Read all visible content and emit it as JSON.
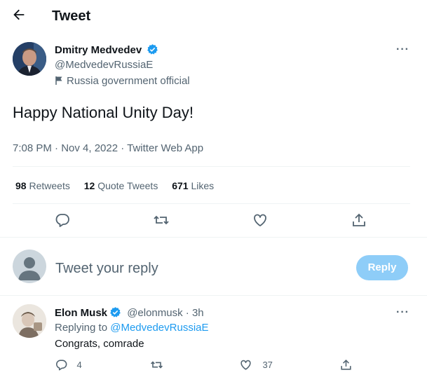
{
  "header": {
    "title": "Tweet",
    "back_icon": "arrow-left-icon"
  },
  "tweet": {
    "author_name": "Dmitry Medvedev",
    "handle": "@MedvedevRussiaE",
    "affiliation": "Russia government official",
    "text": "Happy National Unity Day!",
    "meta": "7:08 PM · Nov 4, 2022 · Twitter Web App",
    "stats": {
      "retweets_count": "98",
      "retweets_label": "Retweets",
      "quotes_count": "12",
      "quotes_label": "Quote Tweets",
      "likes_count": "671",
      "likes_label": "Likes"
    },
    "more_label": "···"
  },
  "composer": {
    "placeholder": "Tweet your reply",
    "reply_button": "Reply"
  },
  "reply": {
    "author_name": "Elon Musk",
    "handle": "@elonmusk",
    "time": "· 3h",
    "replying_to_label": "Replying to",
    "replying_to_handle": "@MedvedevRussiaE",
    "text": "Congrats, comrade",
    "reply_count": "4",
    "like_count": "37",
    "more_label": "···"
  },
  "colors": {
    "accent": "#1d9bf0",
    "muted": "#536471",
    "reply_button_disabled": "#8ecdf8"
  }
}
